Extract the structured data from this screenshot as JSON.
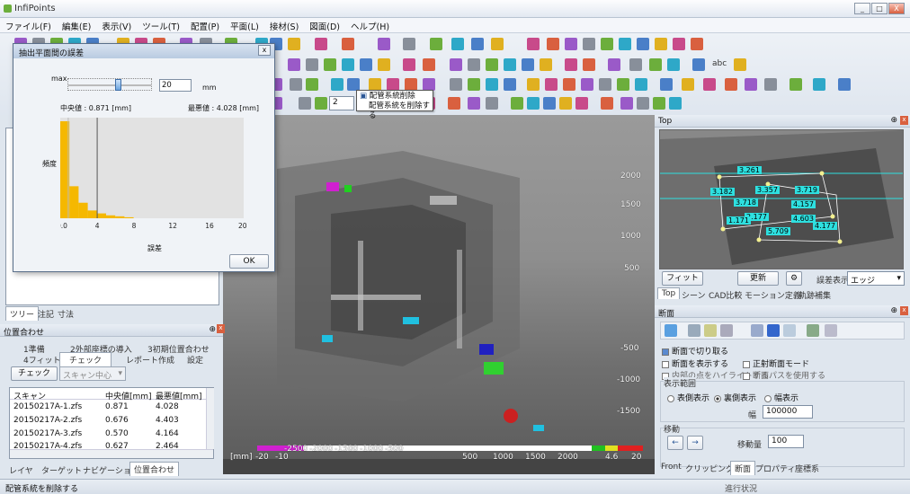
{
  "window": {
    "title": "InfiPoints",
    "min": "_",
    "max": "□",
    "close": "X"
  },
  "menu": [
    "ファイル(F)",
    "編集(E)",
    "表示(V)",
    "ツール(T)",
    "配置(P)",
    "平面(L)",
    "接材(S)",
    "図面(D)",
    "ヘルプ(H)"
  ],
  "toolbar": {
    "combo_value": "2",
    "text_abc": "abc"
  },
  "tooltip": {
    "title": "配管系統削除",
    "desc": "配管系統を削除する"
  },
  "dialog": {
    "title": "抽出平面間の誤差",
    "max_label": "max",
    "max_value": "20",
    "unit": "mm",
    "median": "中央値 : 0.871 [mm]",
    "maxval": "最悪値 : 4.028 [mm]",
    "ylabel": "頻度",
    "xlabel": "誤差",
    "xticks": [
      "0.0",
      "4",
      "8",
      "12",
      "16",
      "20 [mm]"
    ],
    "ok": "OK"
  },
  "chart_data": {
    "type": "bar",
    "x": [
      0.5,
      1.5,
      2.5,
      3.5,
      4.5,
      5.5,
      6.5,
      7.5
    ],
    "values": [
      100,
      33,
      16,
      8,
      5,
      3,
      2,
      1
    ],
    "xlim": [
      0,
      20
    ],
    "xlabel": "誤差",
    "ylabel": "頻度",
    "markers": [
      {
        "x": 0.871,
        "color": "#bbbbbb"
      },
      {
        "x": 4.028,
        "color": "#555555"
      }
    ],
    "bar_color": "#f5b800"
  },
  "left": {
    "tree_tabs": [
      "ツリー",
      "注記",
      "寸法"
    ],
    "align_title": "位置合わせ",
    "steps": [
      "1準備",
      "2外部座標の導入",
      "3初期位置合わせ"
    ],
    "steps2": [
      "4フィット",
      "チェック",
      "レポート作成",
      "設定"
    ],
    "check_btn": "チェック",
    "scan_center": "スキャン中心",
    "table": {
      "headers": [
        "スキャン",
        "中央値[mm]",
        "最悪値[mm]"
      ],
      "rows": [
        [
          "20150217A-1.zfs",
          "0.871",
          "4.028"
        ],
        [
          "20150217A-2.zfs",
          "0.676",
          "4.403"
        ],
        [
          "20150217A-3.zfs",
          "0.570",
          "4.164"
        ],
        [
          "20150217A-4.zfs",
          "0.627",
          "2.464"
        ]
      ]
    },
    "bottom_tabs": [
      "レイヤ",
      "ターゲット",
      "ナビゲーション",
      "位置合わせ"
    ]
  },
  "viewport": {
    "yaxis": [
      "2000",
      "1500",
      "1000",
      "500",
      "-500",
      "-1000",
      "-1500"
    ],
    "scale_unit": "[mm]",
    "scale_left": [
      "-20",
      "-10",
      "-2500",
      "-2000",
      "-1500",
      "-1000",
      "-500"
    ],
    "scale_right": [
      "500",
      "1000",
      "1500",
      "2000",
      "4.6",
      "20"
    ]
  },
  "right": {
    "top_title": "Top",
    "dims": [
      "3.261",
      "3.719",
      "3.357",
      "4.157",
      "3.718",
      "3.182",
      "4.603",
      "4.177",
      "5.709",
      "2.177",
      "1.171"
    ],
    "fit_btn": "フィット",
    "update_btn": "更新",
    "error_display": "誤差表示",
    "edge": "エッジ",
    "view_tabs": [
      "Top",
      "シーン",
      "CAD比較",
      "モーション定義",
      "軌跡補集"
    ],
    "section_title": "断面",
    "opts": [
      "断面で切り取る",
      "断面を表示する",
      "正射断面モード",
      "内部の点をハイライトする",
      "断面パスを使用する"
    ],
    "display_range": "表示範囲",
    "radios": [
      "表側表示",
      "裏側表示",
      "幅表示"
    ],
    "width_label": "幅",
    "width_value": "100000",
    "move_label": "移動",
    "move_amount": "移動量",
    "move_value": "100",
    "bottom_tabs": [
      "Front",
      "クリッピング",
      "断面",
      "プロパティ",
      "座標系"
    ]
  },
  "status": {
    "left": "配管系統を削除する",
    "right": "進行状況"
  },
  "colors": {
    "accent": "#2b5797",
    "bar": "#f5b800"
  }
}
